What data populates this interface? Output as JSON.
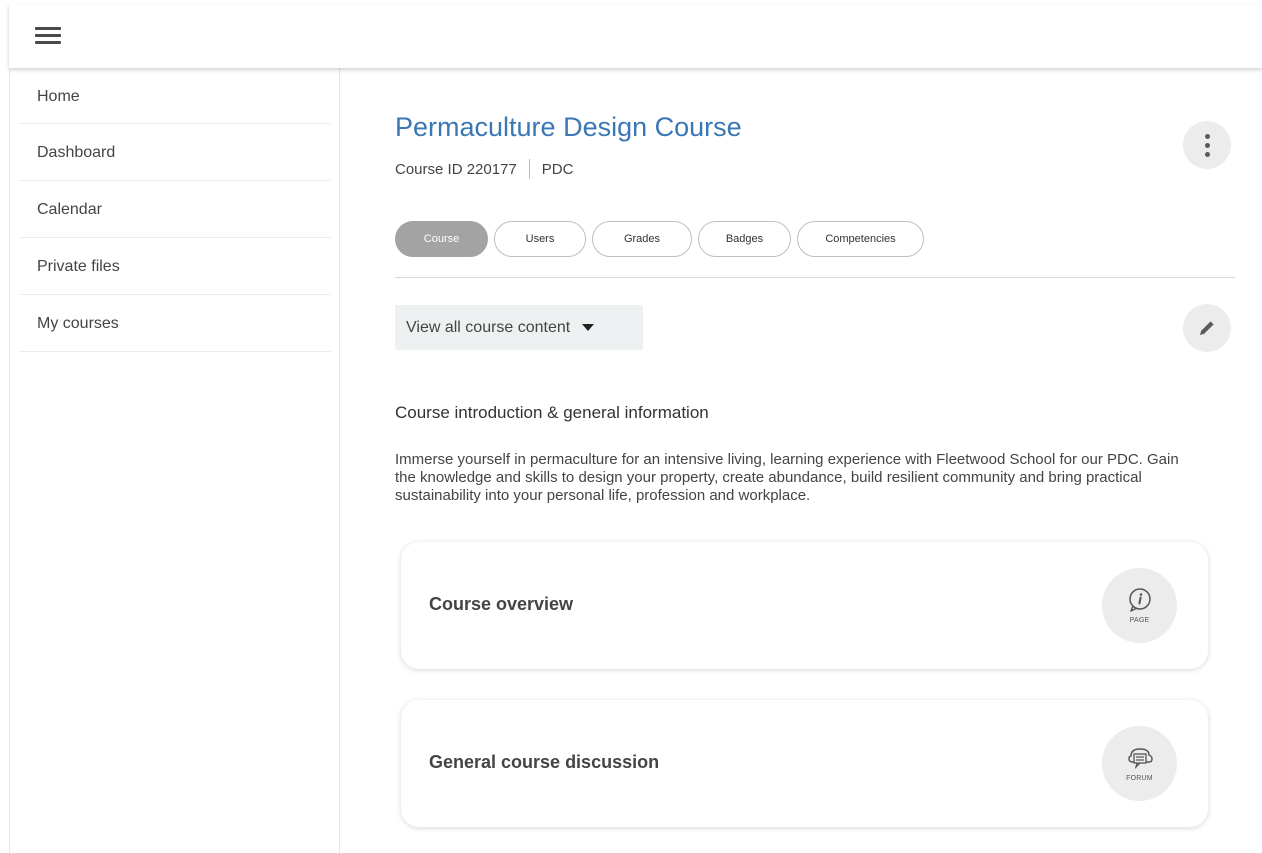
{
  "topbar": {
    "menu_icon": "hamburger-menu-icon"
  },
  "sidebar": {
    "items": [
      {
        "label": "Home"
      },
      {
        "label": "Dashboard"
      },
      {
        "label": "Calendar"
      },
      {
        "label": "Private files"
      },
      {
        "label": "My courses"
      }
    ]
  },
  "course": {
    "title": "Permaculture Design Course",
    "id_label": "Course ID 220177",
    "short_name": "PDC",
    "actions_icon": "kebab-menu-icon"
  },
  "tabs": [
    {
      "label": "Course",
      "active": true
    },
    {
      "label": "Users",
      "active": false
    },
    {
      "label": "Grades",
      "active": false
    },
    {
      "label": "Badges",
      "active": false
    },
    {
      "label": "Competencies",
      "active": false
    }
  ],
  "content_view": {
    "dropdown_label": "View all course content",
    "edit_icon": "pencil-icon"
  },
  "section": {
    "heading": "Course introduction & general information",
    "summary": "Immerse yourself in permaculture for an intensive living, learning experience with Fleetwood School for our PDC. Gain the knowledge and skills to design your property, create abundance, build resilient community and bring practical sustainability into your personal life, profession and workplace."
  },
  "activities": [
    {
      "name": "Course overview",
      "type_label": "PAGE",
      "icon": "info-bubble-icon"
    },
    {
      "name": "General course discussion",
      "type_label": "FORUM",
      "icon": "forum-bubbles-icon"
    }
  ],
  "colors": {
    "title": "#3a77b4",
    "active_tab": "#a3a3a3",
    "icon_circle": "#ececec",
    "dropdown_bg": "#eef1f2"
  }
}
